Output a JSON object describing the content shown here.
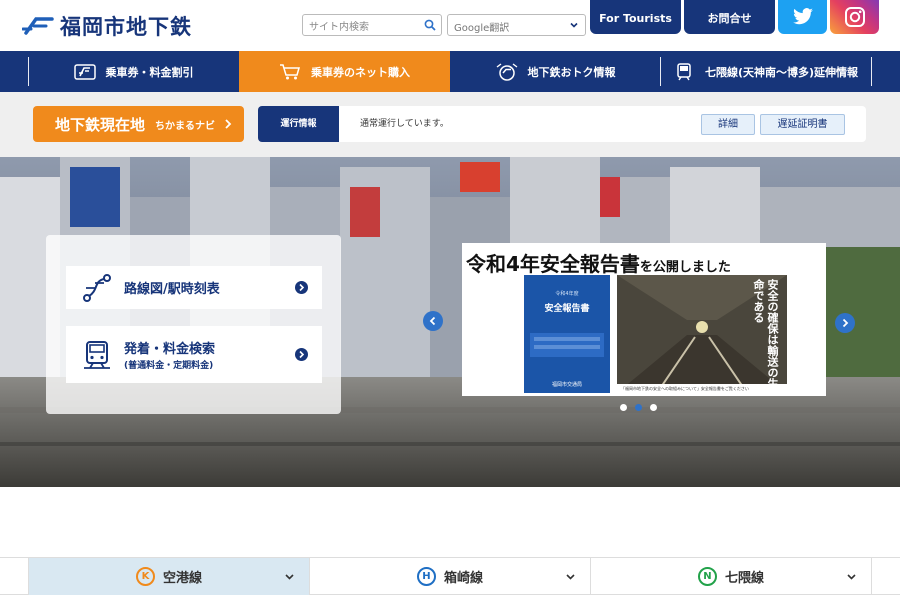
{
  "header": {
    "logo_text": "福岡市地下鉄",
    "search_placeholder": "サイト内検索",
    "translate_label": "Google翻訳",
    "for_tourists": "For Tourists",
    "contact": "お問合せ"
  },
  "nav": {
    "items": [
      {
        "label": "乗車券・料金割引",
        "icon": "ticket-icon"
      },
      {
        "label": "乗車券のネット購入",
        "icon": "cart-icon"
      },
      {
        "label": "地下鉄おトク情報",
        "icon": "coupon-icon"
      },
      {
        "label": "七隈線(天神南〜博多)延伸情報",
        "icon": "train-icon"
      }
    ],
    "active_index": 1
  },
  "infobar": {
    "location_main": "地下鉄現在地",
    "location_sub": "ちかまるナビ",
    "status_label": "運行情報",
    "status_text": "通常運行しています。",
    "detail_button": "詳細",
    "delay_button": "遅延証明書"
  },
  "hero": {
    "quick_links": [
      {
        "label": "路線図/駅時刻表",
        "icon": "route-map-icon"
      },
      {
        "label": "発着・料金検索",
        "sublabel": "(普通料金・定期料金)",
        "icon": "train-front-icon"
      }
    ],
    "banner": {
      "title_main": "令和4年安全報告書",
      "title_tail": "を公開しました",
      "report_year": "令和4年度",
      "report_title": "安全報告書",
      "report_footer": "福岡市交通局",
      "photo_text": "安全の確保は輸送の生命である",
      "caption": "「福岡市地下鉄の安全への取組みについて」安全報告書をご覧ください"
    },
    "slides_count": 3,
    "active_slide": 1
  },
  "lines": [
    {
      "code": "K",
      "name": "空港線",
      "color": "#f08a1c"
    },
    {
      "code": "H",
      "name": "箱崎線",
      "color": "#1f6fc4"
    },
    {
      "code": "N",
      "name": "七隈線",
      "color": "#22a24a"
    }
  ],
  "colors": {
    "brand_navy": "#17357a",
    "accent_orange": "#f08a1c",
    "accent_blue": "#2f72c9"
  }
}
